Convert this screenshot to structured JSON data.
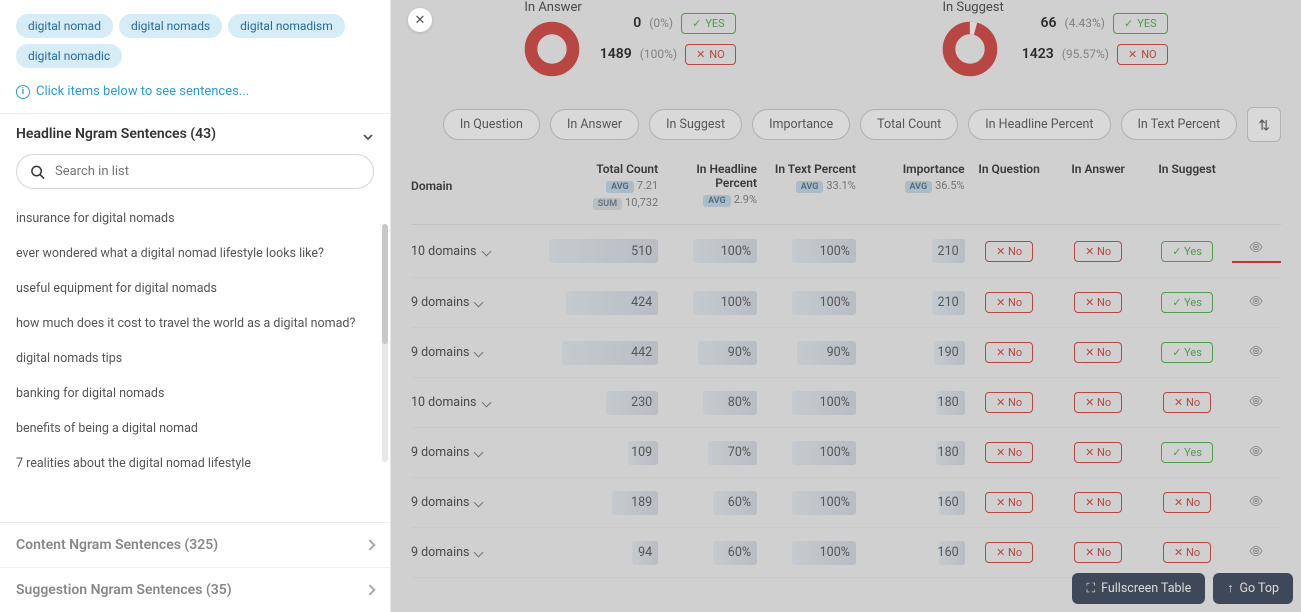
{
  "tags": [
    "digital nomad",
    "digital nomads",
    "digital nomadism",
    "digital nomadic"
  ],
  "hint": "Click items below to see sentences...",
  "sections": {
    "headline": {
      "title": "Headline Ngram Sentences (43)"
    },
    "content": {
      "title": "Content Ngram Sentences (325)"
    },
    "suggestion": {
      "title": "Suggestion Ngram Sentences (35)"
    }
  },
  "search": {
    "placeholder": "Search in list"
  },
  "list": [
    "insurance for digital nomads",
    "ever wondered what a digital nomad lifestyle looks like?",
    "useful equipment for digital nomads",
    "how much does it cost to travel the world as a digital nomad?",
    "digital nomads tips",
    "banking for digital nomads",
    "benefits of being a digital nomad",
    "7 realities about the digital nomad lifestyle"
  ],
  "stats": {
    "answer": {
      "title": "In Answer",
      "yes": {
        "count": "0",
        "pct": "(0%)"
      },
      "no": {
        "count": "1489",
        "pct": "(100%)"
      },
      "slice": 0
    },
    "suggest": {
      "title": "In Suggest",
      "yes": {
        "count": "66",
        "pct": "(4.43%)"
      },
      "no": {
        "count": "1423",
        "pct": "(95.57%)"
      },
      "slice": 4.43
    }
  },
  "yes_label": "YES",
  "no_label": "NO",
  "filters": [
    "In Question",
    "In Answer",
    "In Suggest",
    "Importance",
    "Total Count",
    "In Headline Percent",
    "In Text Percent"
  ],
  "headers": {
    "domain": "Domain",
    "total": {
      "label": "Total Count",
      "avg": "7.21",
      "sum": "10,732"
    },
    "hl": {
      "label": "In Headline Percent",
      "avg": "2.9%"
    },
    "txt": {
      "label": "In Text Percent",
      "avg": "33.1%"
    },
    "imp": {
      "label": "Importance",
      "avg": "36.5%"
    },
    "q": "In Question",
    "a": "In Answer",
    "s": "In Suggest"
  },
  "avg_label": "AVG",
  "sum_label": "SUM",
  "yes_cell": "Yes",
  "no_cell": "No",
  "rows": [
    {
      "domain": "10 domains",
      "total": "510",
      "tw": 100,
      "hl": "100%",
      "hw": 65,
      "txt": "100%",
      "txw": 65,
      "imp": "210",
      "iw": 30,
      "q": "No",
      "a": "No",
      "s": "Yes",
      "red": true
    },
    {
      "domain": "9 domains",
      "total": "424",
      "tw": 85,
      "hl": "100%",
      "hw": 65,
      "txt": "100%",
      "txw": 65,
      "imp": "210",
      "iw": 30,
      "q": "No",
      "a": "No",
      "s": "Yes"
    },
    {
      "domain": "9 domains",
      "total": "442",
      "tw": 88,
      "hl": "90%",
      "hw": 60,
      "txt": "90%",
      "txw": 60,
      "imp": "190",
      "iw": 28,
      "q": "No",
      "a": "No",
      "s": "Yes"
    },
    {
      "domain": "10 domains",
      "total": "230",
      "tw": 48,
      "hl": "80%",
      "hw": 55,
      "txt": "100%",
      "txw": 65,
      "imp": "180",
      "iw": 26,
      "q": "No",
      "a": "No",
      "s": "No"
    },
    {
      "domain": "9 domains",
      "total": "109",
      "tw": 28,
      "hl": "70%",
      "hw": 50,
      "txt": "100%",
      "txw": 65,
      "imp": "180",
      "iw": 26,
      "q": "No",
      "a": "No",
      "s": "Yes"
    },
    {
      "domain": "9 domains",
      "total": "189",
      "tw": 42,
      "hl": "60%",
      "hw": 45,
      "txt": "100%",
      "txw": 65,
      "imp": "160",
      "iw": 24,
      "q": "No",
      "a": "No",
      "s": "No"
    },
    {
      "domain": "9 domains",
      "total": "94",
      "tw": 24,
      "hl": "60%",
      "hw": 45,
      "txt": "100%",
      "txw": 65,
      "imp": "160",
      "iw": 24,
      "q": "No",
      "a": "No",
      "s": "No"
    }
  ],
  "footer": {
    "fullscreen": "Fullscreen Table",
    "gotop": "Go Top"
  }
}
